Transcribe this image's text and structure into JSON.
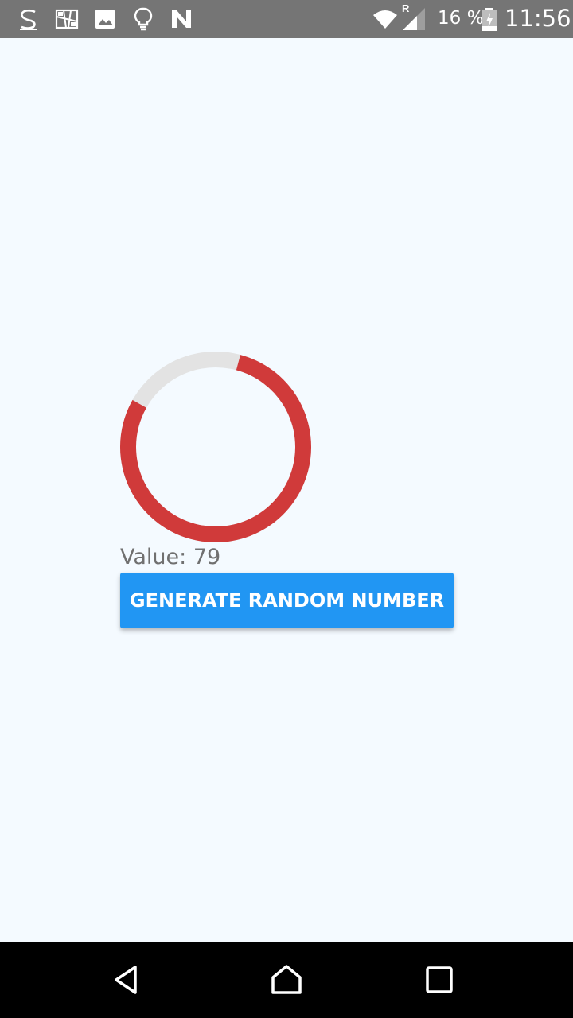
{
  "status_bar": {
    "notification_icons": [
      "s-app-icon",
      "map-icon",
      "image-icon",
      "lightbulb-icon",
      "n-app-icon"
    ],
    "network_label": "R",
    "battery_percent": "16 %",
    "time": "11:56"
  },
  "gauge": {
    "value": 79,
    "max": 100,
    "progress_color": "#d03a3a",
    "track_color": "#e3e3e3"
  },
  "value_label": "Value:",
  "value_text": "79",
  "button": {
    "label": "GENERATE RANDOM NUMBER",
    "color": "#2196f3"
  },
  "nav_bar": {
    "buttons": [
      "back-icon",
      "home-icon",
      "recents-icon"
    ]
  }
}
